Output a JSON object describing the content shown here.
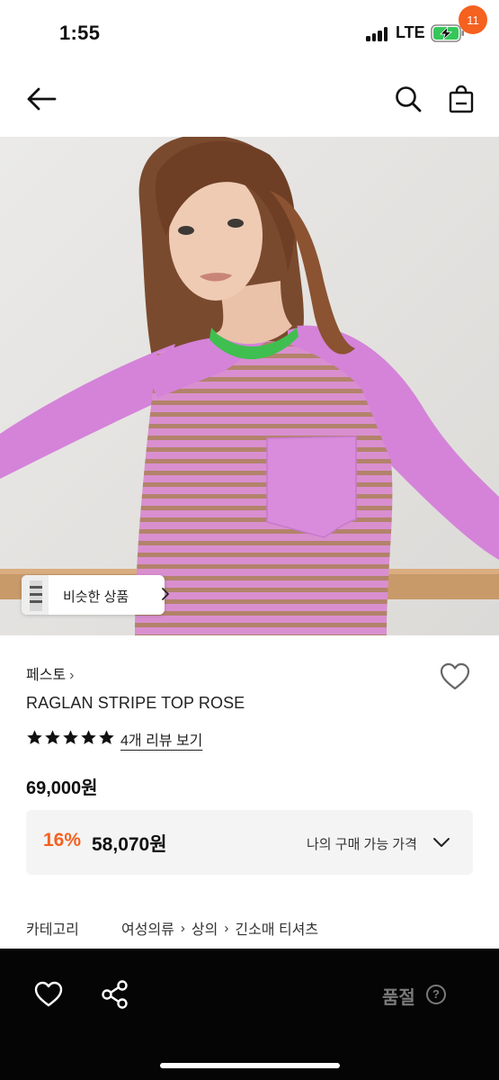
{
  "status_bar": {
    "time": "1:55",
    "network": "LTE"
  },
  "header": {
    "cart_count": "11"
  },
  "product_image": {
    "similar_label": "비슷한 상품"
  },
  "product": {
    "brand": "페스토",
    "name": "RAGLAN STRIPE TOP ROSE",
    "rating_stars": 5,
    "review_link": "4개 리뷰 보기",
    "price": "69,000원",
    "discount": {
      "rate": "16%",
      "price": "58,070원",
      "note": "나의 구매 가능 가격"
    }
  },
  "category": {
    "label": "카테고리",
    "path": [
      "여성의류",
      "상의",
      "긴소매 티셔츠"
    ]
  },
  "bottom_bar": {
    "status": "품절",
    "help_icon": "?"
  },
  "colors": {
    "accent": "#f5611f",
    "bottom_bar_bg": "#050505",
    "discount_box_bg": "#f4f4f5",
    "shirt_pink": "#d483d9",
    "collar_green": "#3fbf4f"
  },
  "icons": [
    "back-arrow-icon",
    "search-icon",
    "cart-icon",
    "heart-icon",
    "star-icon",
    "chevron-down-icon",
    "share-icon",
    "help-icon"
  ]
}
